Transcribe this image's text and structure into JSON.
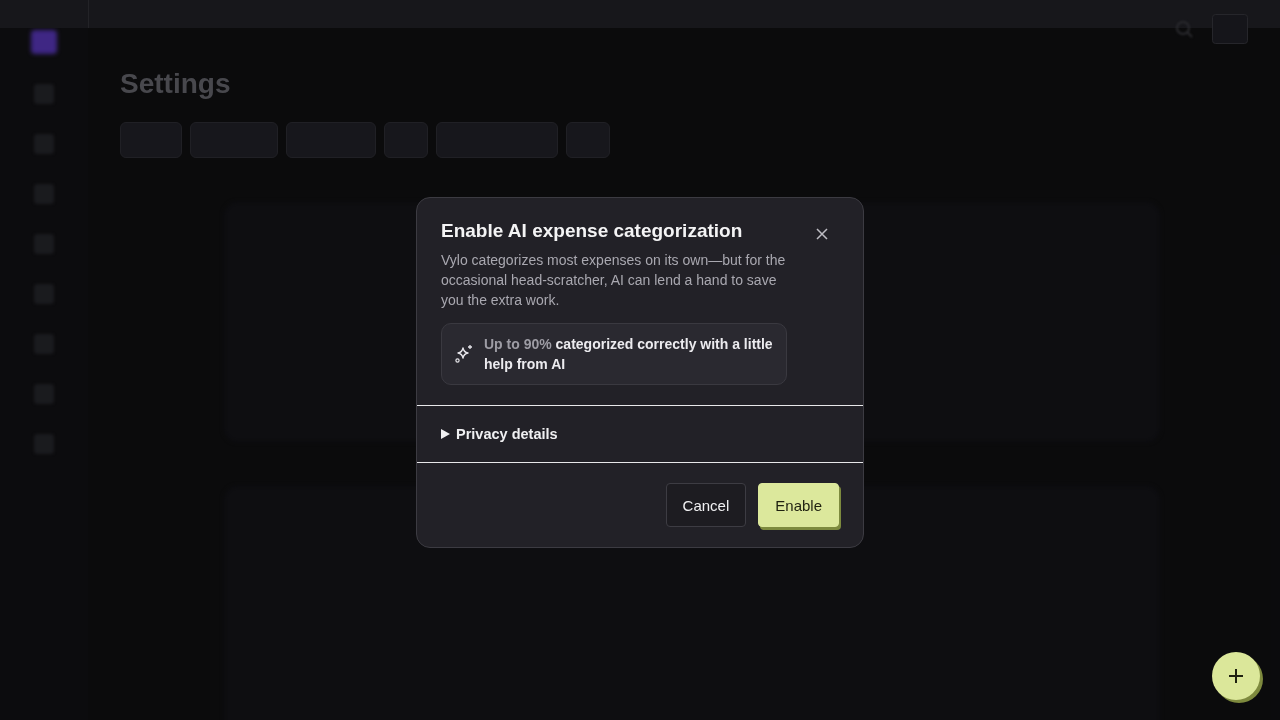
{
  "page": {
    "title": "Settings"
  },
  "dialog": {
    "title": "Enable AI expense categorization",
    "description": "Vylo categorizes most expenses on its own—but for the occasional head-scratcher, AI can lend a hand to save you the extra work.",
    "highlight": "**Up to 90%** categorized correctly with a little help from AI",
    "privacy": {
      "label": "Privacy details",
      "expanded": false
    },
    "buttons": [
      {
        "kind": "secondary",
        "label": "Cancel"
      },
      {
        "kind": "primary",
        "label": "Enable"
      }
    ]
  }
}
